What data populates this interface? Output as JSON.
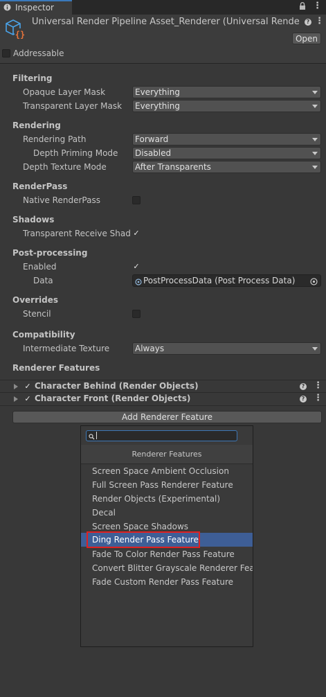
{
  "tab": {
    "label": "Inspector",
    "icon": "info-icon"
  },
  "header": {
    "title": "Universal Render Pipeline Asset_Renderer (Universal Rendere",
    "open_label": "Open",
    "addressable_label": "Addressable"
  },
  "filtering": {
    "title": "Filtering",
    "opaque_label": "Opaque Layer Mask",
    "opaque_value": "Everything",
    "transparent_label": "Transparent Layer Mask",
    "transparent_value": "Everything"
  },
  "rendering": {
    "title": "Rendering",
    "path_label": "Rendering Path",
    "path_value": "Forward",
    "depth_priming_label": "Depth Priming Mode",
    "depth_priming_value": "Disabled",
    "depth_texture_label": "Depth Texture Mode",
    "depth_texture_value": "After Transparents"
  },
  "renderpass": {
    "title": "RenderPass",
    "native_label": "Native RenderPass",
    "native_checked": false
  },
  "shadows": {
    "title": "Shadows",
    "transparent_receive_label": "Transparent Receive Shado",
    "transparent_receive_checked": true
  },
  "postprocessing": {
    "title": "Post-processing",
    "enabled_label": "Enabled",
    "enabled_checked": true,
    "data_label": "Data",
    "data_value": "PostProcessData (Post Process Data)"
  },
  "overrides": {
    "title": "Overrides",
    "stencil_label": "Stencil",
    "stencil_checked": false
  },
  "compatibility": {
    "title": "Compatibility",
    "intermediate_label": "Intermediate Texture",
    "intermediate_value": "Always"
  },
  "renderer_features": {
    "title": "Renderer Features",
    "items": [
      {
        "label": "Character Behind (Render Objects)",
        "enabled": true
      },
      {
        "label": "Character Front (Render Objects)",
        "enabled": true
      }
    ],
    "add_label": "Add Renderer Feature"
  },
  "popup": {
    "search_value": "",
    "header": "Renderer Features",
    "items": [
      "Screen Space Ambient Occlusion",
      "Full Screen Pass Renderer Feature",
      "Render Objects (Experimental)",
      "Decal",
      "Screen Space Shadows",
      "Ding Render Pass Feature",
      "Fade To Color Render Pass Feature",
      "Convert Blitter Grayscale Renderer Feature",
      "Fade Custom Render Pass Feature"
    ],
    "selected_index": 5
  },
  "colors": {
    "background": "#383838",
    "selection": "#3e5e96",
    "highlight_border": "#e02020",
    "accent": "#3a79bb"
  }
}
